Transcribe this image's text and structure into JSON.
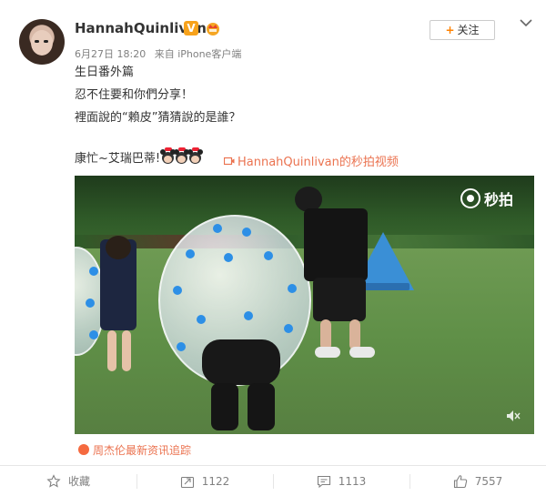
{
  "post": {
    "username": "HannahQuinlivan",
    "verified_badge": "V",
    "date": "6月27日 18:20",
    "source": "来自 iPhone客户端",
    "follow_label": "关注",
    "lines": [
      "生日番外篇",
      "忍不住要和你們分享！",
      "裡面說的“賴皮”猜猜說的是誰？",
      "康忙~艾瑞巴蒂!"
    ],
    "video_link": "HannahQuinlivan的秒拍视频",
    "watermark": "秒拍",
    "repost_source": "周杰伦最新资讯追踪"
  },
  "actions": [
    {
      "label": "收藏",
      "icon": "star-icon"
    },
    {
      "label": "1122",
      "icon": "repost-icon"
    },
    {
      "label": "1113",
      "icon": "comment-icon"
    },
    {
      "label": "7557",
      "icon": "like-icon"
    }
  ],
  "colors": {
    "accent": "#eb7350",
    "follow_plus": "#ff8200",
    "badge": "#f7a21b",
    "muted_text": "#808080"
  }
}
